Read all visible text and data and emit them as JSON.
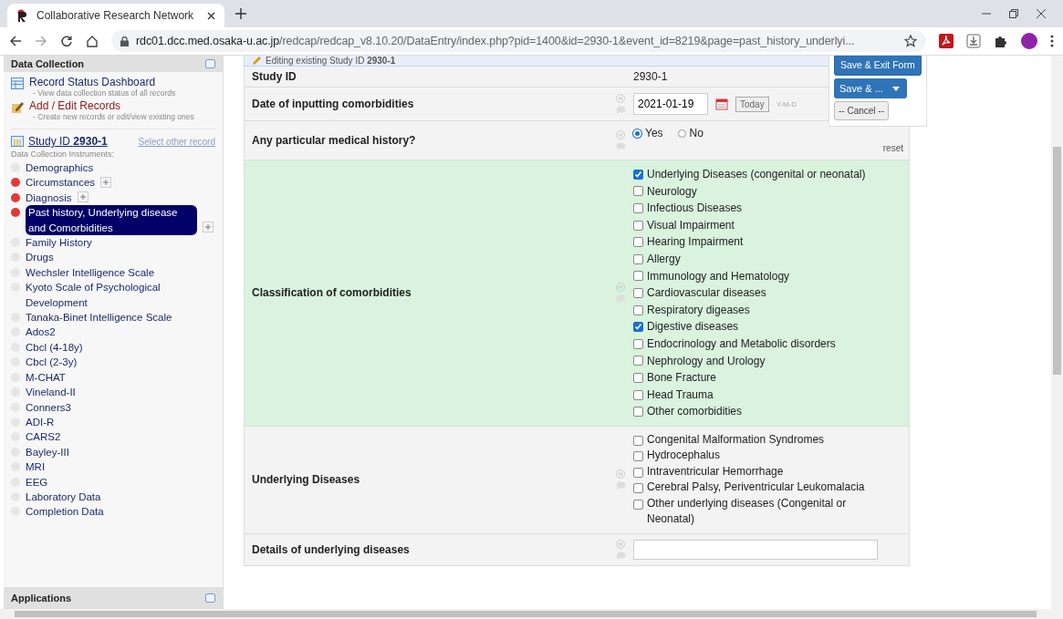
{
  "browser": {
    "tab_title": "Collaborative Research Network",
    "url_host": "rdc01.dcc.med.osaka-u.ac.jp",
    "url_path": "/redcap/redcap_v8.10.20/DataEntry/index.php?pid=1400&id=2930-1&event_id=8219&page=past_history_underlyi..."
  },
  "sidebar": {
    "section_title": "Data Collection",
    "links": [
      {
        "kind": "dashboard",
        "label": "Record Status Dashboard",
        "description": "- View data collection status of all records"
      },
      {
        "kind": "records",
        "label": "Add / Edit Records",
        "description": "- Create new records or edit/view existing ones"
      }
    ],
    "record": {
      "label": "Study ID",
      "id": "2930-1",
      "select_link": "Select other record"
    },
    "instruments_label": "Data Collection Instruments:",
    "instruments": [
      {
        "name": "Demographics",
        "color": "#e6e6e6",
        "selected": false,
        "repeatable": false
      },
      {
        "name": "Circumstances",
        "color": "#e53935",
        "selected": false,
        "repeatable": true
      },
      {
        "name": "Diagnosis",
        "color": "#e53935",
        "selected": false,
        "repeatable": true
      },
      {
        "name": "Past history, Underlying disease and Comorbidities",
        "color": "#e53935",
        "selected": true,
        "repeatable": true
      },
      {
        "name": "Family History",
        "color": "#e6e6e6",
        "selected": false,
        "repeatable": false
      },
      {
        "name": "Drugs",
        "color": "#e6e6e6",
        "selected": false,
        "repeatable": false
      },
      {
        "name": "Wechsler Intelligence Scale",
        "color": "#e6e6e6",
        "selected": false,
        "repeatable": false
      },
      {
        "name": "Kyoto Scale of Psychological Development",
        "color": "#e6e6e6",
        "selected": false,
        "repeatable": false
      },
      {
        "name": "Tanaka-Binet Intelligence Scale",
        "color": "#e6e6e6",
        "selected": false,
        "repeatable": false
      },
      {
        "name": "Ados2",
        "color": "#e6e6e6",
        "selected": false,
        "repeatable": false
      },
      {
        "name": "Cbcl (4-18y)",
        "color": "#e6e6e6",
        "selected": false,
        "repeatable": false
      },
      {
        "name": "Cbcl (2-3y)",
        "color": "#e6e6e6",
        "selected": false,
        "repeatable": false
      },
      {
        "name": "M-CHAT",
        "color": "#e6e6e6",
        "selected": false,
        "repeatable": false
      },
      {
        "name": "Vineland-II",
        "color": "#e6e6e6",
        "selected": false,
        "repeatable": false
      },
      {
        "name": "Conners3",
        "color": "#e6e6e6",
        "selected": false,
        "repeatable": false
      },
      {
        "name": "ADI-R",
        "color": "#e6e6e6",
        "selected": false,
        "repeatable": false
      },
      {
        "name": "CARS2",
        "color": "#e6e6e6",
        "selected": false,
        "repeatable": false
      },
      {
        "name": "Bayley-III",
        "color": "#e6e6e6",
        "selected": false,
        "repeatable": false
      },
      {
        "name": "MRI",
        "color": "#e6e6e6",
        "selected": false,
        "repeatable": false
      },
      {
        "name": "EEG",
        "color": "#e6e6e6",
        "selected": false,
        "repeatable": false
      },
      {
        "name": "Laboratory Data",
        "color": "#e6e6e6",
        "selected": false,
        "repeatable": false
      },
      {
        "name": "Completion Data",
        "color": "#e6e6e6",
        "selected": false,
        "repeatable": false
      }
    ],
    "applications_title": "Applications"
  },
  "form": {
    "banner": "Editing existing Study ID **2930-1**",
    "fields": [
      {
        "kind": "readonly",
        "label": "Study ID",
        "value": "2930-1"
      },
      {
        "kind": "date",
        "label": "Date of inputting comorbidities",
        "value": "2021-01-19",
        "today_button": "Today",
        "format_hint": "Y-M-D"
      },
      {
        "kind": "radio",
        "label": "Any particular medical history?",
        "reset": "reset",
        "options": [
          {
            "label": "Yes",
            "selected": true
          },
          {
            "label": "No",
            "selected": false
          }
        ]
      },
      {
        "kind": "checkbox",
        "label": "Classification of comorbidities",
        "highlighted": true,
        "options": [
          {
            "label": "Underlying Diseases (congenital or neonatal)",
            "checked": true
          },
          {
            "label": "Neurology",
            "checked": false
          },
          {
            "label": "Infectious Diseases",
            "checked": false
          },
          {
            "label": "Visual Impairment",
            "checked": false
          },
          {
            "label": "Hearing Impairment",
            "checked": false
          },
          {
            "label": "Allergy",
            "checked": false
          },
          {
            "label": "Immunology and Hematology",
            "checked": false
          },
          {
            "label": "Cardiovascular diseases",
            "checked": false
          },
          {
            "label": "Respiratory digeases",
            "checked": false
          },
          {
            "label": "Digestive diseases",
            "checked": true
          },
          {
            "label": "Endocrinology and Metabolic disorders",
            "checked": false
          },
          {
            "label": "Nephrology and Urology",
            "checked": false
          },
          {
            "label": "Bone Fracture",
            "checked": false
          },
          {
            "label": "Head Trauma",
            "checked": false
          },
          {
            "label": "Other comorbidities",
            "checked": false
          }
        ]
      },
      {
        "kind": "checkbox",
        "label": "Underlying Diseases",
        "highlighted": false,
        "options": [
          {
            "label": "Congenital Malformation Syndromes",
            "checked": false
          },
          {
            "label": "Hydrocephalus",
            "checked": false
          },
          {
            "label": "Intraventricular Hemorrhage",
            "checked": false
          },
          {
            "label": "Cerebral Palsy, Periventricular Leukomalacia",
            "checked": false
          },
          {
            "label": "Other underlying diseases (Congenital or Neonatal)",
            "checked": false
          }
        ]
      },
      {
        "kind": "input",
        "label": "Details of underlying diseases"
      }
    ]
  },
  "actions": {
    "save_exit": "Save & Exit Form",
    "save_more": "Save & ...",
    "cancel": "-- Cancel --"
  }
}
